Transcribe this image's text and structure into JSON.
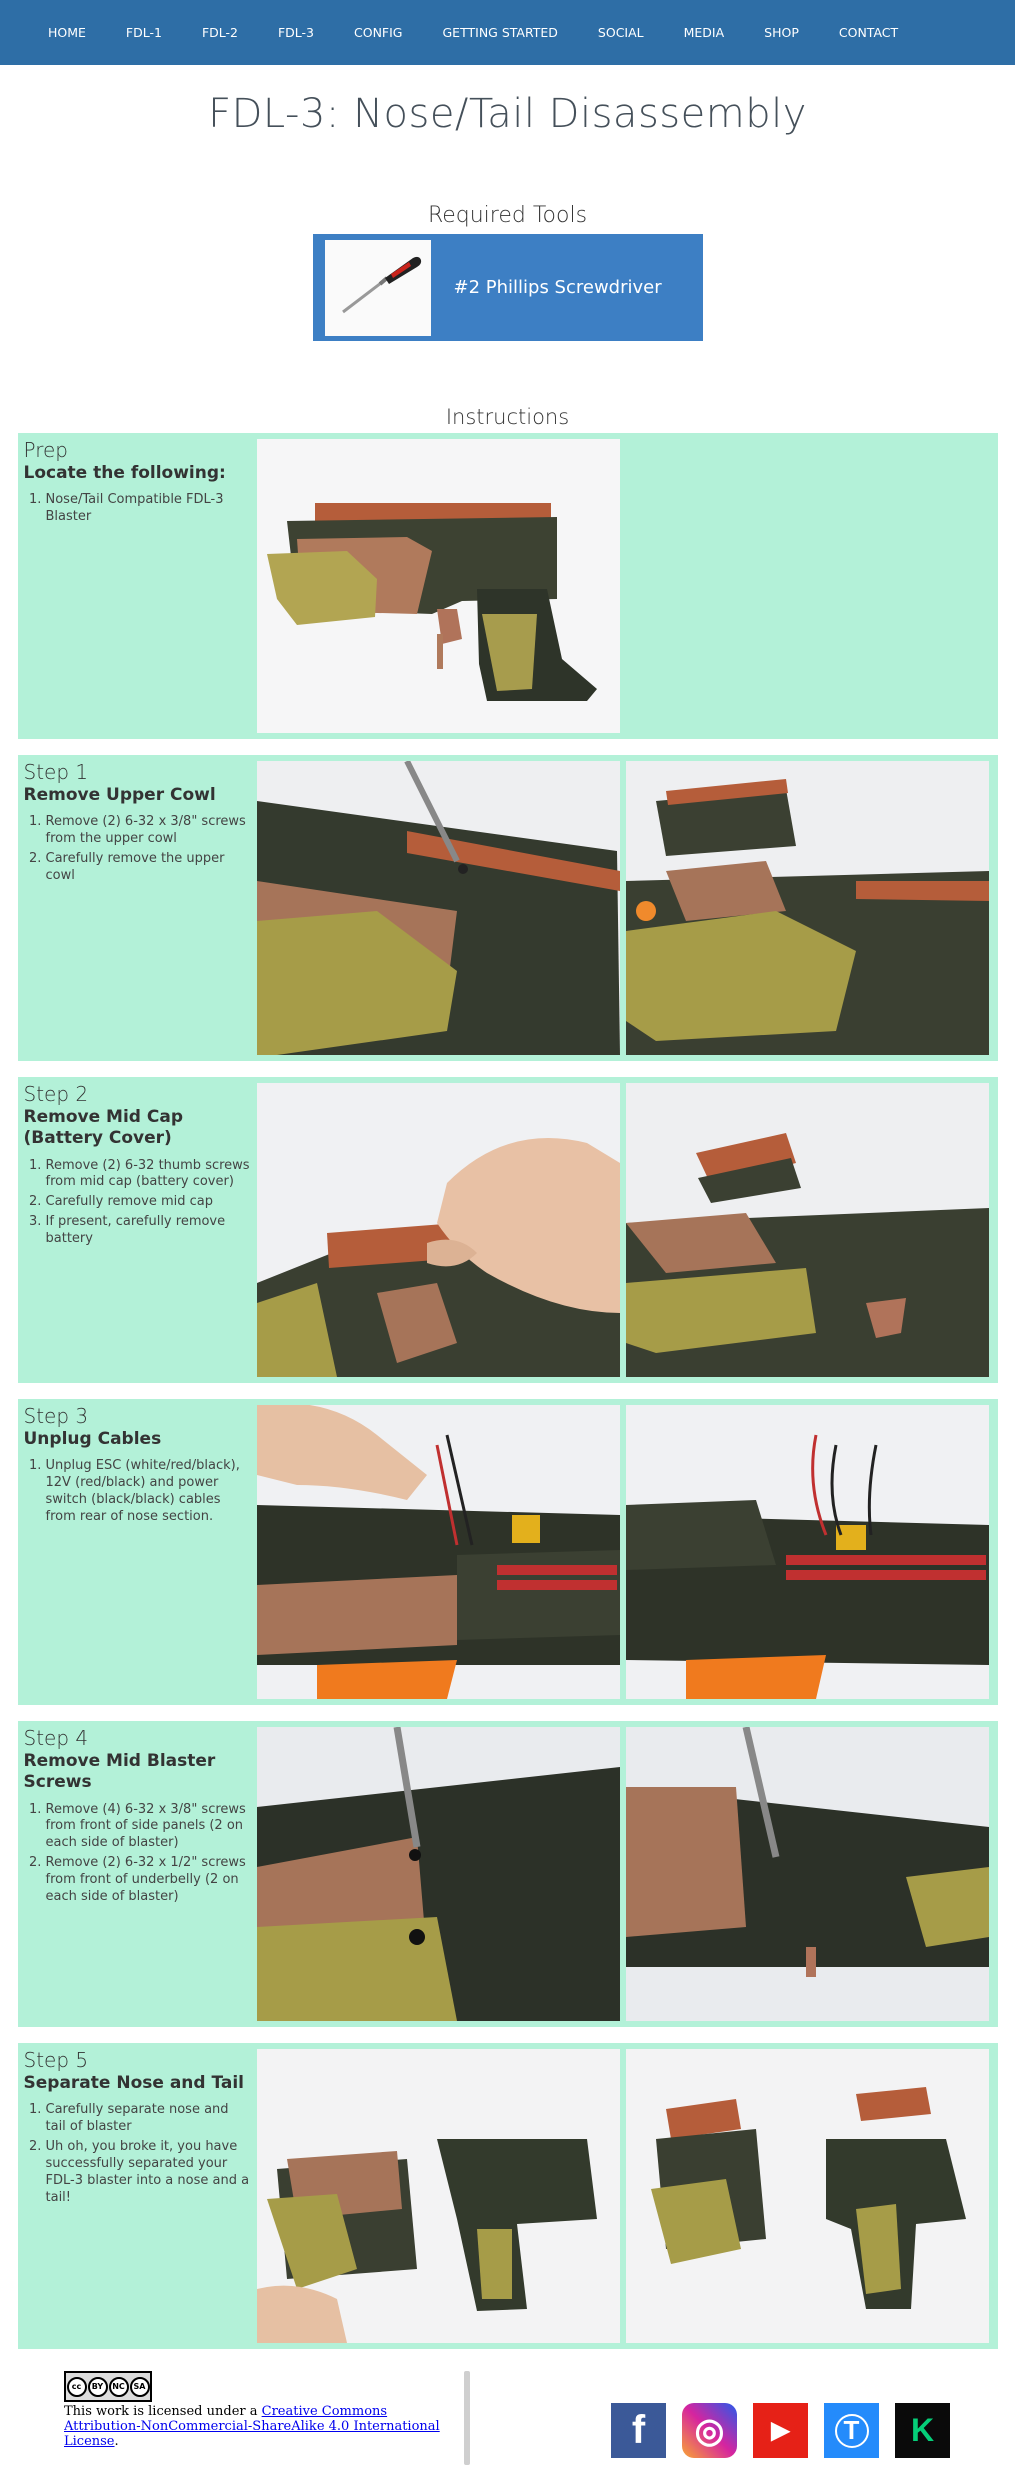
{
  "nav": {
    "items": [
      "HOME",
      "FDL-1",
      "FDL-2",
      "FDL-3",
      "CONFIG",
      "GETTING STARTED",
      "SOCIAL",
      "MEDIA",
      "SHOP",
      "CONTACT"
    ],
    "bg_color": "#2e6ea6"
  },
  "page": {
    "title": "FDL-3: Nose/Tail Disassembly"
  },
  "tools": {
    "heading": "Required Tools",
    "items": [
      {
        "label": "#2 Phillips Screwdriver",
        "icon": "screwdriver-icon"
      }
    ],
    "card_color": "#3d7fc4"
  },
  "instructions": {
    "heading": "Instructions",
    "step_bg_color": "#b3f1d8",
    "steps": [
      {
        "title": "Prep",
        "subtitle": "Locate the following:",
        "items": [
          "Nose/Tail Compatible FDL-3 Blaster"
        ]
      },
      {
        "title": "Step 1",
        "subtitle": "Remove Upper Cowl",
        "items": [
          "Remove (2) 6-32 x 3/8\" screws from the upper cowl",
          "Carefully remove the upper cowl"
        ]
      },
      {
        "title": "Step 2",
        "subtitle": "Remove Mid Cap (Battery Cover)",
        "items": [
          "Remove (2) 6-32 thumb screws from mid cap (battery cover)",
          "Carefully remove mid cap",
          "If present, carefully remove battery"
        ]
      },
      {
        "title": "Step 3",
        "subtitle": "Unplug Cables",
        "items": [
          "Unplug ESC (white/red/black), 12V (red/black) and power switch (black/black) cables from rear of nose section."
        ]
      },
      {
        "title": "Step 4",
        "subtitle": "Remove Mid Blaster Screws",
        "items": [
          "Remove (4) 6-32 x 3/8\" screws from front of side panels (2 on each side of blaster)",
          "Remove (2) 6-32 x 1/2\" screws from front of underbelly (2 on each side of blaster)"
        ]
      },
      {
        "title": "Step 5",
        "subtitle": "Separate Nose and Tail",
        "items": [
          "Carefully separate nose and tail of blaster",
          "Uh oh, you broke it, you have successfully separated your FDL-3 blaster into a nose and a tail!"
        ]
      }
    ]
  },
  "footer": {
    "license_badge": [
      "cc",
      "BY",
      "NC",
      "SA"
    ],
    "license_prefix": "This work is licensed under a ",
    "license_link": "Creative Commons Attribution-NonCommercial-ShareAlike 4.0 International License",
    "license_suffix": ".",
    "social": [
      {
        "name": "facebook-icon",
        "glyph": "f",
        "color": "#3b5998"
      },
      {
        "name": "instagram-icon",
        "glyph": "◎",
        "color": "#c13584"
      },
      {
        "name": "youtube-icon",
        "glyph": "▶",
        "color": "#e62117"
      },
      {
        "name": "thingiverse-icon",
        "glyph": "T",
        "color": "#248bfb"
      },
      {
        "name": "kickstarter-icon",
        "glyph": "K",
        "color": "#05ce78"
      }
    ]
  }
}
